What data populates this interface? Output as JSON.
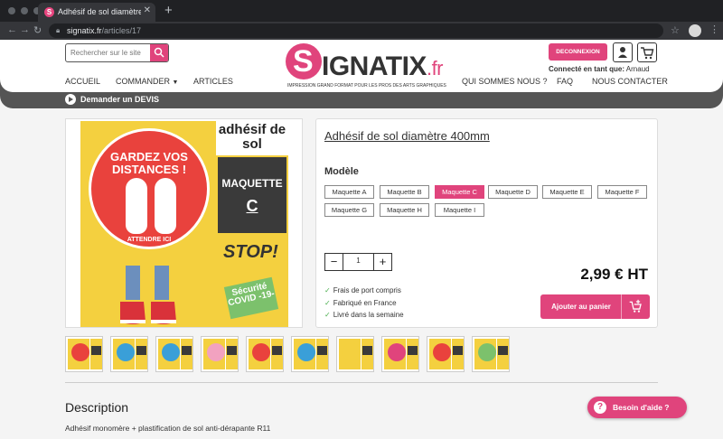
{
  "browser": {
    "tab_title": "Adhésif de sol diamètre 400mm",
    "tab_favicon": "S",
    "url_host": "signatix.fr",
    "url_path": "/articles/17"
  },
  "header": {
    "search_placeholder": "Rechercher sur le site",
    "logo_letter": "S",
    "logo_name": "IGNATIX",
    "logo_suffix": ".fr",
    "logo_tagline": "IMPRESSION GRAND FORMAT POUR LES PROS DES ARTS GRAPHIQUES",
    "logout_label": "DECONNEXION",
    "connected_label": "Connecté en tant que:",
    "connected_user": "Arnaud",
    "nav_left": [
      "ACCUEIL",
      "COMMANDER",
      "ARTICLES"
    ],
    "nav_right": [
      "QUI SOMMES NOUS ?",
      "FAQ",
      "NOUS CONTACTER"
    ]
  },
  "devis_label": "Demander un DEVIS",
  "product_image": {
    "gardez": "GARDEZ VOS",
    "distances": "DISTANCES !",
    "attendre": "ATTENDRE ICI",
    "side_title": "adhésif de sol",
    "maquette": "MAQUETTE",
    "maquette_letter": "C",
    "stop": "STOP!",
    "covid": "Sécurité COVID -19-"
  },
  "thumbnail_colors": [
    "#e9423d",
    "#3a9fd8",
    "#3a9fd8",
    "#f2a2c0",
    "#e9423d",
    "#3a9fd8",
    "#f4d03f",
    "#e0447c",
    "#e9423d",
    "#7cc16c"
  ],
  "product": {
    "title": "Adhésif de sol diamètre 400mm",
    "modele_label": "Modèle",
    "variants": [
      "Maquette A",
      "Maquette B",
      "Maquette C",
      "Maquette D",
      "Maquette E",
      "Maquette F",
      "Maquette G",
      "Maquette H",
      "Maquette I"
    ],
    "selected_variant": "Maquette C",
    "quantity": "1",
    "price": "2,99 € HT",
    "features": [
      "Frais de port compris",
      "Fabriqué en France",
      "Livré dans la semaine"
    ],
    "add_to_cart": "Ajouter au panier"
  },
  "description": {
    "title": "Description",
    "text": "Adhésif monomère + plastification de sol anti-dérapante R11"
  },
  "help_label": "Besoin d'aide ?",
  "colors": {
    "accent": "#e0447c",
    "sticker_yellow": "#f4d03f",
    "sticker_red": "#e9423d"
  }
}
